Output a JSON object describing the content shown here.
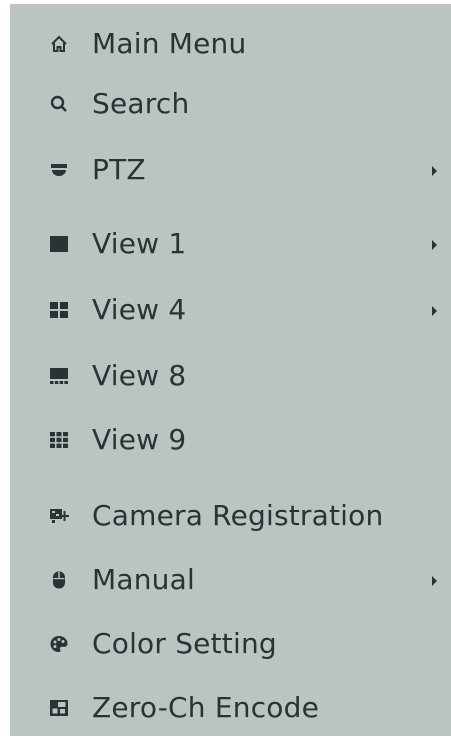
{
  "menu": {
    "items": [
      {
        "label": "Main Menu",
        "icon": "home-icon",
        "submenu": false
      },
      {
        "label": "Search",
        "icon": "search-icon",
        "submenu": false
      },
      {
        "label": "PTZ",
        "icon": "ptz-camera-icon",
        "submenu": true
      },
      {
        "label": "View 1",
        "icon": "view-1-icon",
        "submenu": true
      },
      {
        "label": "View 4",
        "icon": "view-4-icon",
        "submenu": true
      },
      {
        "label": "View 8",
        "icon": "view-8-icon",
        "submenu": false
      },
      {
        "label": "View 9",
        "icon": "view-9-icon",
        "submenu": false
      },
      {
        "label": "Camera Registration",
        "icon": "camera-registration-icon",
        "submenu": false
      },
      {
        "label": "Manual",
        "icon": "mouse-icon",
        "submenu": true
      },
      {
        "label": "Color Setting",
        "icon": "color-palette-icon",
        "submenu": false
      },
      {
        "label": "Zero-Ch Encode",
        "icon": "zero-channel-encode-icon",
        "submenu": false
      }
    ]
  },
  "colors": {
    "background": "#bcc4c2",
    "text": "#2b3236",
    "icon": "#2b3236"
  }
}
